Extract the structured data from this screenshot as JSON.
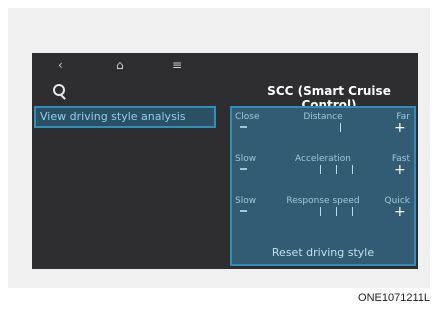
{
  "nav": {
    "back_icon": "back-icon",
    "home_icon": "home-icon",
    "menu_icon": "menu-icon",
    "search_icon": "search-icon"
  },
  "panel": {
    "title": "SCC (Smart Cruise Control)"
  },
  "left_menu": {
    "items": [
      {
        "label": "View driving style analysis"
      }
    ]
  },
  "settings": {
    "rows": [
      {
        "left": "Close",
        "center": "Distance",
        "right": "Far"
      },
      {
        "left": "Slow",
        "center": "Acceleration",
        "right": "Fast"
      },
      {
        "left": "Slow",
        "center": "Response speed",
        "right": "Quick"
      }
    ],
    "reset_label": "Reset driving style"
  },
  "caption": "ONE1071211L"
}
